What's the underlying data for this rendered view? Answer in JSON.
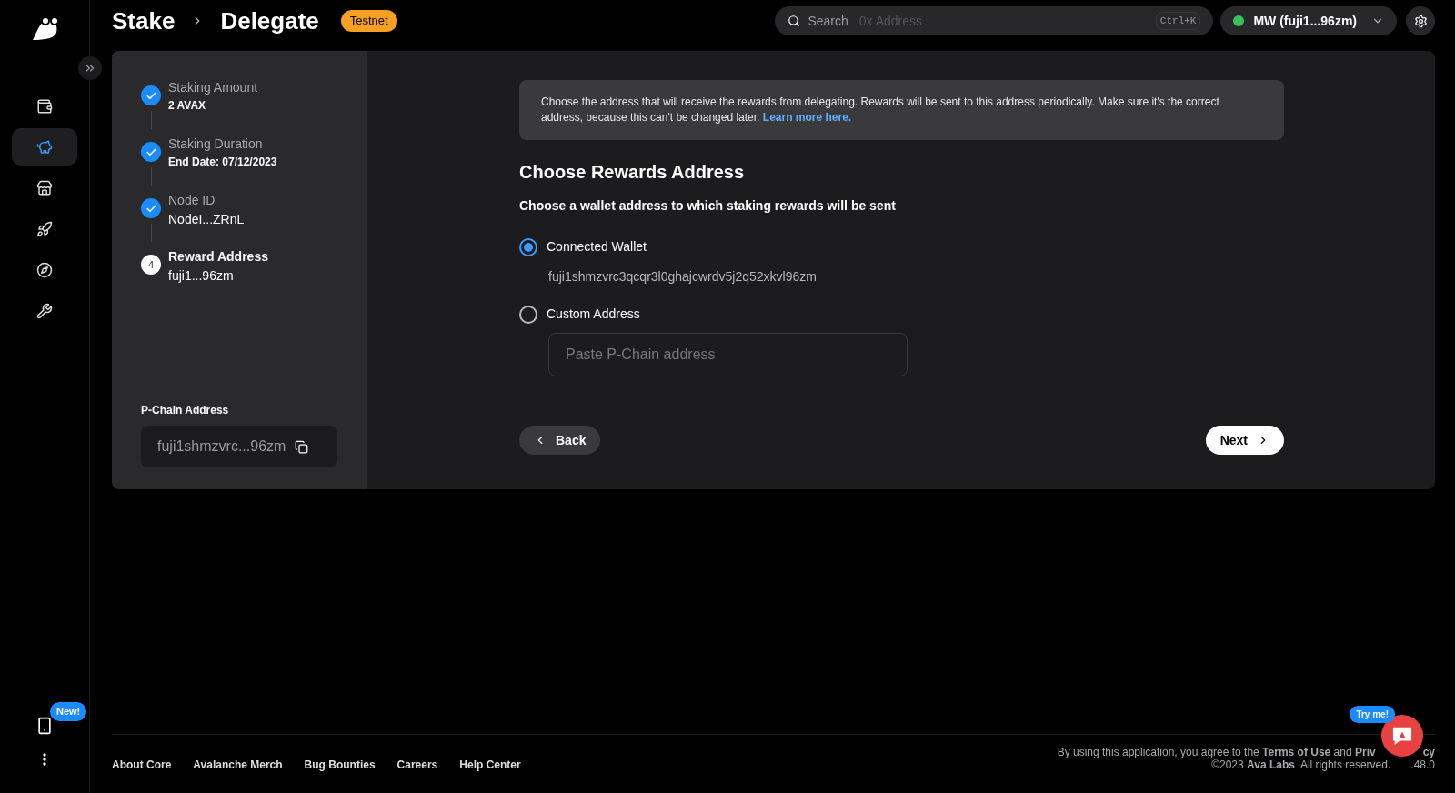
{
  "header": {
    "breadcrumbs": [
      "Stake",
      "Delegate"
    ],
    "badge": "Testnet",
    "search": {
      "placeholder": "Search",
      "hint": "0x Address",
      "shortcut": "Ctrl+K"
    },
    "account": {
      "name": "MW (fuji1...96zm)",
      "connected": true
    }
  },
  "sidebar": {
    "items": [
      {
        "kind": "wallet",
        "selected": false
      },
      {
        "kind": "stake",
        "selected": true
      },
      {
        "kind": "store",
        "selected": false
      },
      {
        "kind": "rocket",
        "selected": false
      },
      {
        "kind": "compass",
        "selected": false
      },
      {
        "kind": "tools",
        "selected": false
      }
    ],
    "promo_badge": "New!"
  },
  "steps": [
    {
      "title": "Staking Amount",
      "value": "2 AVAX",
      "completed": true,
      "value_bold": true
    },
    {
      "title": "Staking Duration",
      "value": "End Date: 07/12/2023",
      "completed": true,
      "value_bold": true
    },
    {
      "title": "Node ID",
      "value": "NodeI...ZRnL",
      "completed": true,
      "value_bold": false
    },
    {
      "title": "Reward Address",
      "value": "fuji1...96zm",
      "completed": false,
      "number": "4",
      "value_bold": false
    }
  ],
  "p_chain": {
    "label": "P-Chain Address",
    "value": "fuji1shmzvrc...96zm"
  },
  "info": {
    "text": "Choose the address that will receive the rewards from delegating. Rewards will be sent to this address periodically. Make sure it's the correct address, because this can't be changed later.",
    "link": "Learn more here."
  },
  "heading": "Choose Rewards Address",
  "subheading": "Choose a wallet address to which staking rewards will be sent",
  "options": [
    {
      "kind": "wallet",
      "label": "Connected Wallet",
      "selected": true,
      "value": "fuji1shmzvrc3qcqr3l0ghajcwrdv5j2q52xkvl96zm"
    },
    {
      "kind": "custom",
      "label": "Custom Address",
      "selected": false,
      "placeholder": "Paste P-Chain address"
    }
  ],
  "buttons": {
    "back": "Back",
    "next": "Next"
  },
  "footer": {
    "links": [
      "About Core",
      "Avalanche Merch",
      "Bug Bounties",
      "Careers",
      "Help Center"
    ],
    "legal_line_1": "By using this application, you agree to the **Terms of Use** and **Priv**",
    "legal_line_1_tail": "**cy**",
    "legal_line_2": "©2023 **Ava Labs**  All rights reserved.",
    "legal_line_2_tail": ".48.0"
  },
  "chat": {
    "badge": "Try me!"
  }
}
